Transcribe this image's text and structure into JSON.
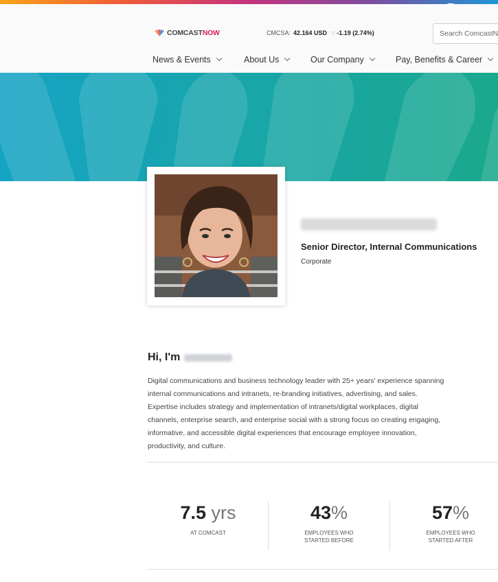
{
  "brand": {
    "logo_prefix": "COMCAST",
    "logo_suffix": "NOW",
    "logo_accent_color": "#d81e5b",
    "peacock_colors": [
      "#f7a418",
      "#ef5a3b",
      "#c4337e",
      "#7c4ea0",
      "#1d97d6",
      "#45b549"
    ]
  },
  "ticker": {
    "symbol": "CMCSA:",
    "price": "42.164 USD",
    "change": "-1.19 (2.74%)",
    "direction_icon": "triangle-down-icon"
  },
  "search": {
    "placeholder": "Search ComcastNow"
  },
  "nav": {
    "items": [
      {
        "label": "News & Events"
      },
      {
        "label": "About Us"
      },
      {
        "label": "Our Company"
      },
      {
        "label": "Pay, Benefits & Career"
      }
    ]
  },
  "hero": {
    "gradient_start": "#15a3c4",
    "gradient_end": "#1aa88d"
  },
  "profile": {
    "photo_alt": "Profile photo",
    "job_title": "Senior Director, Internal Communications",
    "department": "Corporate"
  },
  "about": {
    "greeting": "Hi, I'm",
    "bio_lines": [
      "Digital communications and business technology leader with 25+ years' experience spanning",
      "internal communications and intranets, re-branding initiatives, advertising, and sales.",
      "Expertise includes strategy and implementation of intranets/digital workplaces, digital",
      "channels, enterprise search, and enterprise social with a strong focus on creating engaging,",
      "informative, and accessible digital experiences that encourage employee innovation,",
      "productivity, and culture."
    ]
  },
  "stats": [
    {
      "value": "7.5",
      "unit": "yrs",
      "label": "AT COMCAST"
    },
    {
      "value": "43",
      "unit": "%",
      "label": "EMPLOYEES WHO STARTED BEFORE"
    },
    {
      "value": "57",
      "unit": "%",
      "label": "EMPLOYEES WHO STARTED AFTER"
    }
  ]
}
